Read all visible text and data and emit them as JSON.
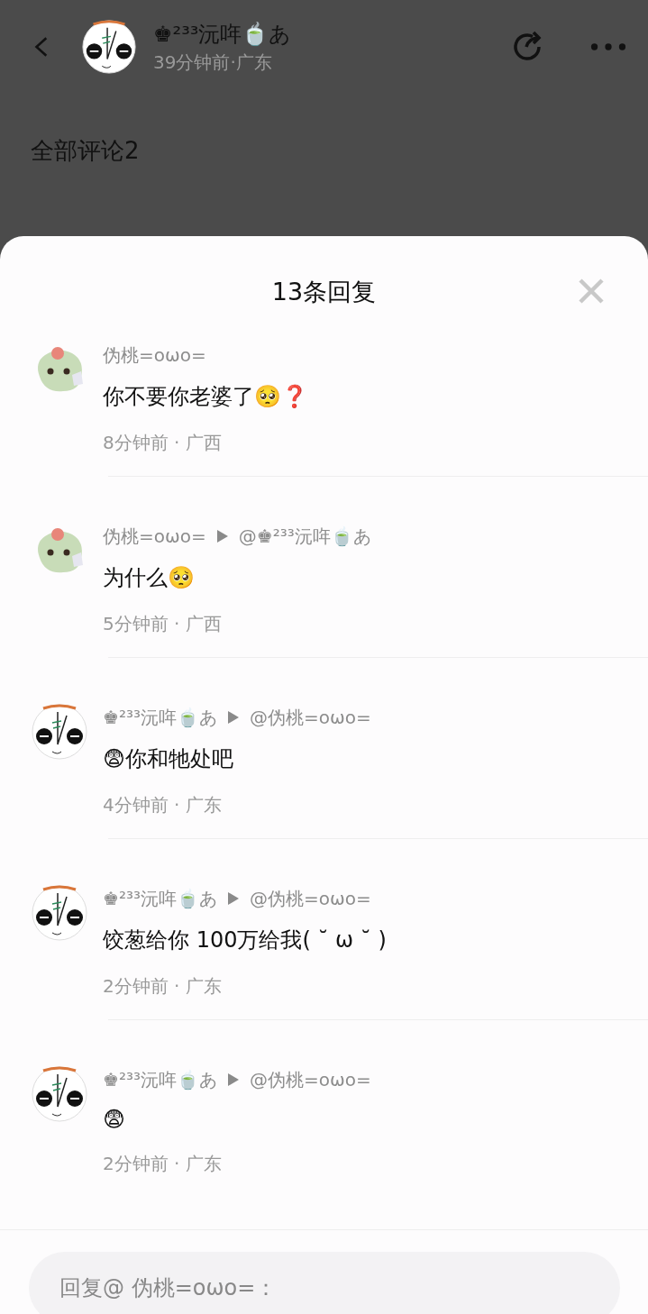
{
  "post_header": {
    "author": "♚²³³沅哖🍵あ",
    "meta": "39分钟前·广东"
  },
  "comments_title": "全部评论2",
  "sheet": {
    "title": "13条回复",
    "replies": [
      {
        "author": "伪桃=oωo=",
        "text": "你不要你老婆了🥺❓",
        "meta": "8分钟前 · 广西"
      },
      {
        "author": "伪桃=oωo=",
        "reply_to": "@♚²³³沅哖🍵あ",
        "text": "为什么🥺",
        "meta": "5分钟前 · 广西"
      },
      {
        "author": "♚²³³沅哖🍵あ",
        "reply_to": "@伪桃=oωo=",
        "text": "😨你和牠处吧",
        "meta": "4分钟前 · 广东"
      },
      {
        "author": "♚²³³沅哖🍵あ",
        "reply_to": "@伪桃=oωo=",
        "text": "饺葱给你 100万给我( ˘ ω ˘ )",
        "meta": "2分钟前 · 广东"
      },
      {
        "author": "♚²³³沅哖🍵あ",
        "reply_to": "@伪桃=oωo=",
        "text": "😨",
        "meta": "2分钟前 · 广东"
      }
    ],
    "reply_field": {
      "placeholder": "回复@ 伪桃=oωo=："
    }
  }
}
